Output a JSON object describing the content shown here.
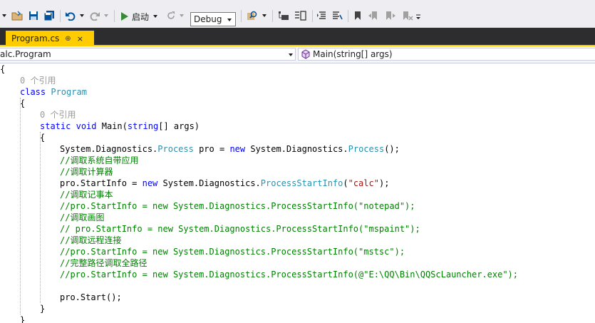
{
  "toolbar": {
    "start_label": "启动",
    "config_value": "Debug"
  },
  "tab": {
    "label": "Program.cs",
    "pin_glyph": "⊕",
    "close_glyph": "×"
  },
  "navbar": {
    "left": "alc.Program",
    "right": "Main(string[] args)"
  },
  "code": {
    "l1": "{",
    "l2_ref": "0 个引用",
    "l3_kw": "class",
    "l3_ty": "Program",
    "l4": "{",
    "l5_ref": "0 个引用",
    "l6_a": "static",
    "l6_b": "void",
    "l6_c": "Main(",
    "l6_d": "string",
    "l6_e": "[] args)",
    "l7": "{",
    "l8_a": "System.Diagnostics.",
    "l8_b": "Process",
    "l8_c": " pro = ",
    "l8_d": "new",
    "l8_e": " System.Diagnostics.",
    "l8_f": "Process",
    "l8_g": "();",
    "l9": "//调取系统自带应用",
    "l10": "//调取计算器",
    "l11_a": "pro.StartInfo = ",
    "l11_b": "new",
    "l11_c": " System.Diagnostics.",
    "l11_d": "ProcessStartInfo",
    "l11_e": "(",
    "l11_f": "\"calc\"",
    "l11_g": ");",
    "l12": "//调取记事本",
    "l13": "//pro.StartInfo = new System.Diagnostics.ProcessStartInfo(\"notepad\");",
    "l14": "//调取画图",
    "l15": "// pro.StartInfo = new System.Diagnostics.ProcessStartInfo(\"mspaint\");",
    "l16": "//调取远程连接",
    "l17": "//pro.StartInfo = new System.Diagnostics.ProcessStartInfo(\"mstsc\");",
    "l18": "//完整路径调取全路径",
    "l19": "//pro.StartInfo = new System.Diagnostics.ProcessStartInfo(@\"E:\\QQ\\Bin\\QQScLauncher.exe\");",
    "l21": "pro.Start();",
    "l22": "}",
    "l23": "}"
  }
}
